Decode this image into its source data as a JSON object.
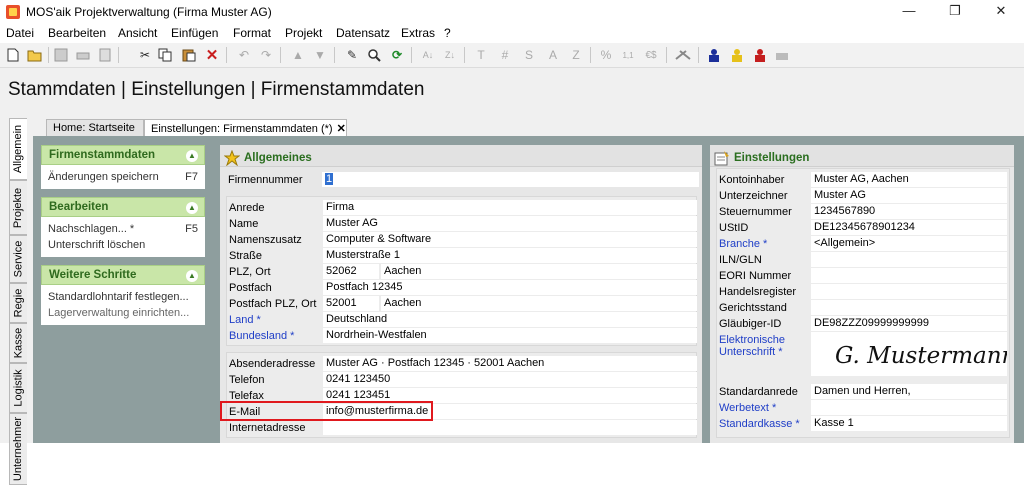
{
  "window": {
    "title": "MOS'aik Projektverwaltung (Firma Muster AG)",
    "min_glyph": "—",
    "max_glyph": "❐",
    "close_glyph": "✕"
  },
  "menu": [
    "Datei",
    "Bearbeiten",
    "Ansicht",
    "Einfügen",
    "Format",
    "Projekt",
    "Datensatz",
    "Extras",
    "?"
  ],
  "toolbar_icons": [
    "new-icon",
    "open-icon",
    "save-icon",
    "print-icon",
    "preview-icon",
    "cut-icon",
    "copy-icon",
    "paste-icon",
    "delete-icon",
    "undo-icon",
    "redo-icon",
    "move-up-icon",
    "move-down-icon",
    "edit-icon",
    "find-icon",
    "refresh-icon",
    "sort-asc-icon",
    "sort-desc-icon",
    "text-icon",
    "number-icon",
    "sum-icon",
    "a-icon",
    "percent-icon",
    "decimal-icon",
    "currency-icon",
    "tools-icon",
    "user-blue-icon",
    "user-yellow-icon",
    "user-red-icon",
    "printer-gray-icon"
  ],
  "toolbar_glyphs": {
    "t": "T",
    "hash": "#",
    "s": "S",
    "a": "A",
    "z": "Z",
    "pct": "%",
    "dec": "1,1",
    "eur": "€$"
  },
  "header": {
    "title": "Stammdaten | Einstellungen | Firmenstammdaten"
  },
  "side_tabs": [
    "Allgemein",
    "Projekte",
    "Service",
    "Regie",
    "Kasse",
    "Logistik",
    "Unternehmer"
  ],
  "doc_tabs": [
    {
      "label": "Home: Startseite"
    },
    {
      "label": "Einstellungen: Firmenstammdaten (*)",
      "close": "✕"
    }
  ],
  "taskpane": {
    "sections": [
      {
        "title": "Firmenstammdaten",
        "items": [
          {
            "label": "Änderungen speichern",
            "key": "F7"
          }
        ]
      },
      {
        "title": "Bearbeiten",
        "items": [
          {
            "label": "Nachschlagen... *",
            "key": "F5"
          },
          {
            "label": "Unterschrift löschen",
            "key": ""
          }
        ]
      },
      {
        "title": "Weitere Schritte",
        "items": [
          {
            "label": "Standardlohntarif festlegen...",
            "key": ""
          },
          {
            "label": "Lagerverwaltung einrichten...",
            "key": ""
          }
        ]
      }
    ]
  },
  "allgemeines": {
    "title": "Allgemeines",
    "firmennummer": {
      "label": "Firmennummer",
      "value": "1"
    },
    "address": [
      {
        "label": "Anrede",
        "value": "Firma"
      },
      {
        "label": "Name",
        "value": "Muster AG"
      },
      {
        "label": "Namenszusatz",
        "value": "Computer & Software"
      },
      {
        "label": "Straße",
        "value": "Musterstraße 1"
      },
      {
        "label": "PLZ, Ort",
        "value": "52062",
        "value2": "Aachen"
      },
      {
        "label": "Postfach",
        "value": "Postfach 12345"
      },
      {
        "label": "Postfach PLZ, Ort",
        "value": "52001",
        "value2": "Aachen"
      },
      {
        "label": "Land *",
        "value": "Deutschland",
        "link": true
      },
      {
        "label": "Bundesland *",
        "value": "Nordrhein-Westfalen",
        "link": true
      }
    ],
    "contact": [
      {
        "label": "Absenderadresse",
        "value": "Muster AG · Postfach 12345 · 52001 Aachen"
      },
      {
        "label": "Telefon",
        "value": "0241 123450"
      },
      {
        "label": "Telefax",
        "value": "0241 123451"
      },
      {
        "label": "E-Mail",
        "value": "info@musterfirma.de"
      },
      {
        "label": "Internetadresse",
        "value": ""
      }
    ]
  },
  "einstellungen": {
    "title": "Einstellungen",
    "rows": [
      {
        "label": "Kontoinhaber",
        "value": "Muster AG, Aachen"
      },
      {
        "label": "Unterzeichner",
        "value": "Muster AG"
      },
      {
        "label": "Steuernummer",
        "value": "1234567890"
      },
      {
        "label": "UStID",
        "value": "DE12345678901234"
      },
      {
        "label": "Branche *",
        "value": "<Allgemein>",
        "link": true
      },
      {
        "label": "ILN/GLN",
        "value": ""
      },
      {
        "label": "EORI Nummer",
        "value": ""
      },
      {
        "label": "Handelsregister",
        "value": ""
      },
      {
        "label": "Gerichtsstand",
        "value": ""
      },
      {
        "label": "Gläubiger-ID",
        "value": "DE98ZZZ09999999999"
      }
    ],
    "signature": {
      "label": "Elektronische Unterschrift *",
      "value": "G. Mustermann"
    },
    "rows2": [
      {
        "label": "Standardanrede",
        "value": "Damen und Herren,"
      },
      {
        "label": "Werbetext *",
        "value": "",
        "link": true
      },
      {
        "label": "Standardkasse *",
        "value": "Kasse 1",
        "link": true
      }
    ]
  },
  "colors": {
    "accent_green": "#2a6e1f",
    "link_blue": "#1f3ec7",
    "highlight_red": "#e0191e",
    "workspace_gray": "#8e9e9e"
  }
}
